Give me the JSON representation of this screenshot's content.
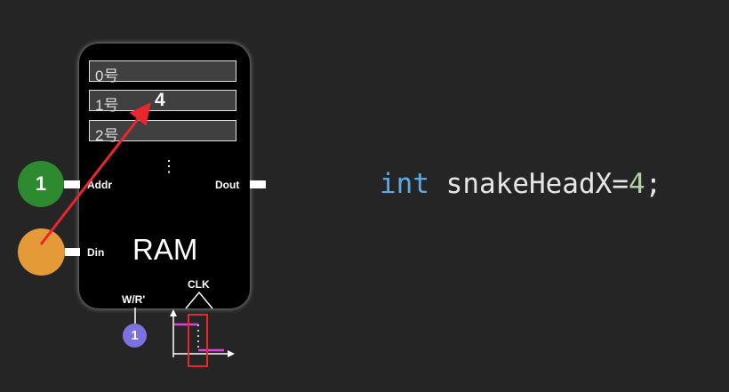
{
  "ram": {
    "title": "RAM",
    "slots": [
      {
        "label": "0号",
        "value": ""
      },
      {
        "label": "1号",
        "value": "4"
      },
      {
        "label": "2号",
        "value": ""
      }
    ],
    "ellipsis": "⋮",
    "addr_label": "Addr",
    "din_label": "Din",
    "dout_label": "Dout",
    "wr_label": "W/R'",
    "clk_label": "CLK"
  },
  "inputs": {
    "addr_value": "1",
    "wr_value": "1"
  },
  "code": {
    "keyword": "int",
    "identifier": " snakeHeadX",
    "operator": "=",
    "number": "4",
    "terminator": ";"
  },
  "colors": {
    "background": "#252525",
    "ram_body": "#000000",
    "addr_circle": "#2e8a2e",
    "din_circle": "#e39a37",
    "wr_circle": "#7b72e0",
    "arrow": "#e8262c",
    "clock_signal": "#e040e0",
    "highlight_box": "#e8262c",
    "keyword": "#5fa8e0",
    "number": "#b5cea8"
  }
}
